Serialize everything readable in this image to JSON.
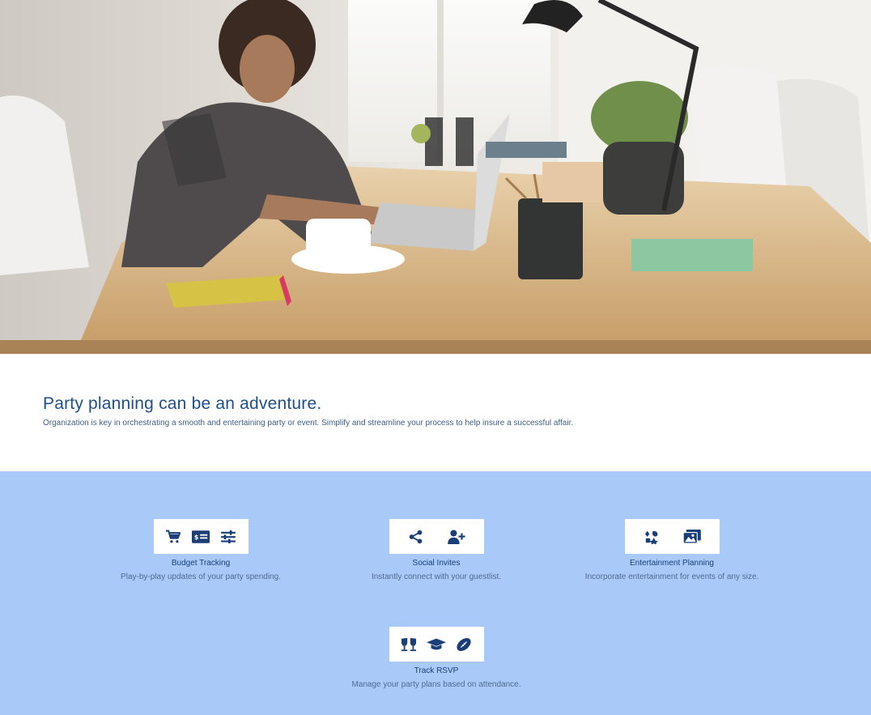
{
  "intro": {
    "heading": "Party planning can be an adventure.",
    "text": "Organization is key in orchestrating a smooth and entertaining party or event. Simplify and streamline your process to help insure a successful affair."
  },
  "features": [
    {
      "title": "Budget Tracking",
      "description": "Play-by-play updates of your party spending.",
      "icons": [
        "cart-icon",
        "money-card-icon",
        "sliders-icon"
      ]
    },
    {
      "title": "Social Invites",
      "description": "Instantly connect with your guestlist.",
      "icons": [
        "share-icon",
        "add-user-icon"
      ]
    },
    {
      "title": "Entertainment Planning",
      "description": "Incorporate entertainment for events of any size.",
      "icons": [
        "entertainment-icon",
        "photo-gallery-icon"
      ]
    },
    {
      "title": "Track RSVP",
      "description": "Manage your party plans based on attendance.",
      "icons": [
        "glasses-cheers-icon",
        "graduation-cap-icon",
        "football-icon"
      ]
    }
  ],
  "colors": {
    "heading": "#1f4f8b",
    "features_bg": "#a9c9f8",
    "icon": "#1a3f78"
  }
}
